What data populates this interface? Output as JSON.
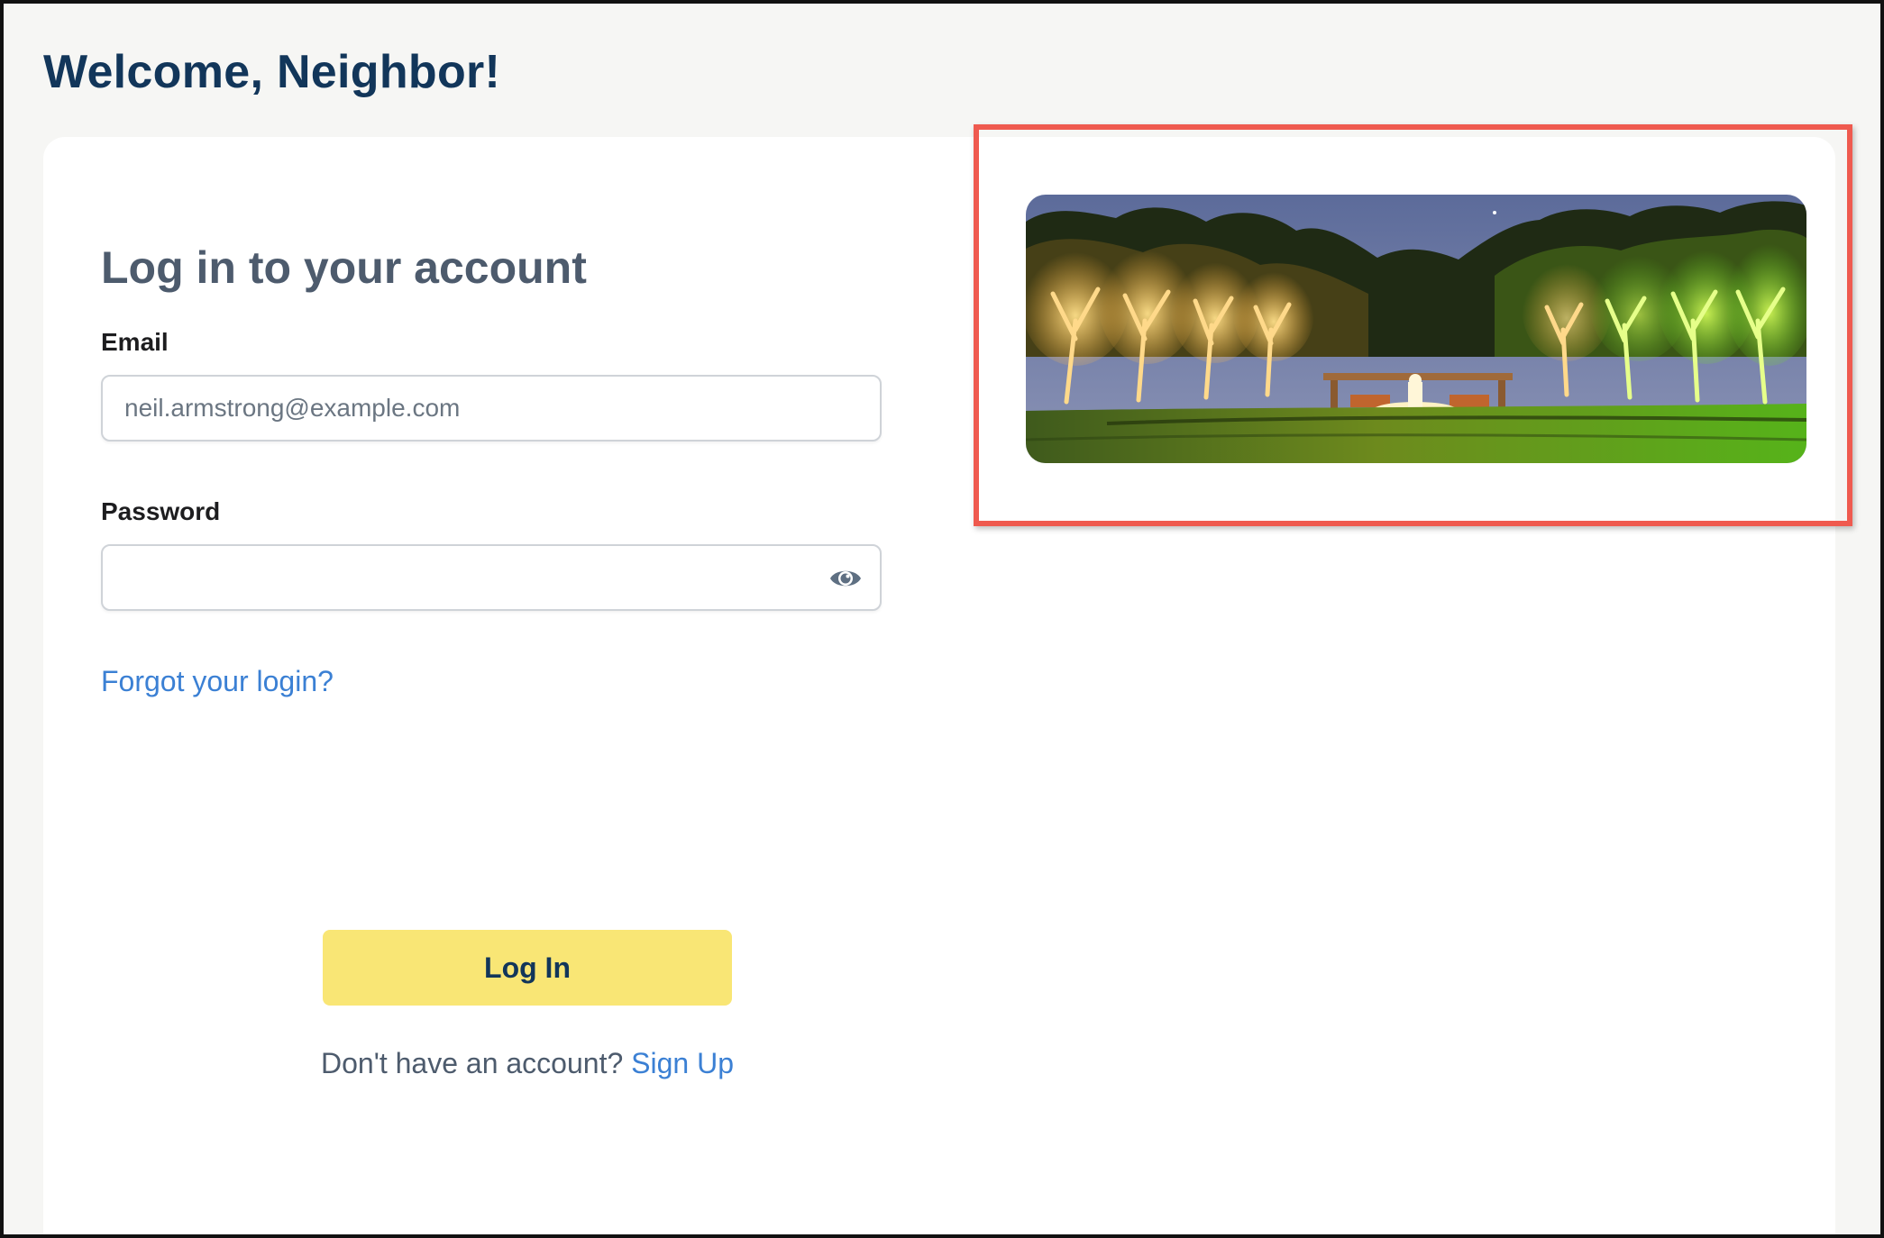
{
  "page": {
    "welcome": "Welcome, Neighbor!"
  },
  "login": {
    "title": "Log in to your account",
    "email_label": "Email",
    "email_placeholder": "neil.armstrong@example.com",
    "email_value": "",
    "password_label": "Password",
    "password_value": "",
    "password_toggle_icon": "eye-icon",
    "forgot_link": "Forgot your login?",
    "submit_label": "Log In",
    "signup_prompt": "Don't have an account?",
    "signup_link": "Sign Up"
  },
  "banner": {
    "subject": "night-garden-landscape-lighting",
    "highlighted": true
  },
  "colors": {
    "heading": "#12365a",
    "title": "#4d5b6d",
    "link": "#3b80d4",
    "button": "#f9e675",
    "highlight_border": "#ef5a4f"
  }
}
